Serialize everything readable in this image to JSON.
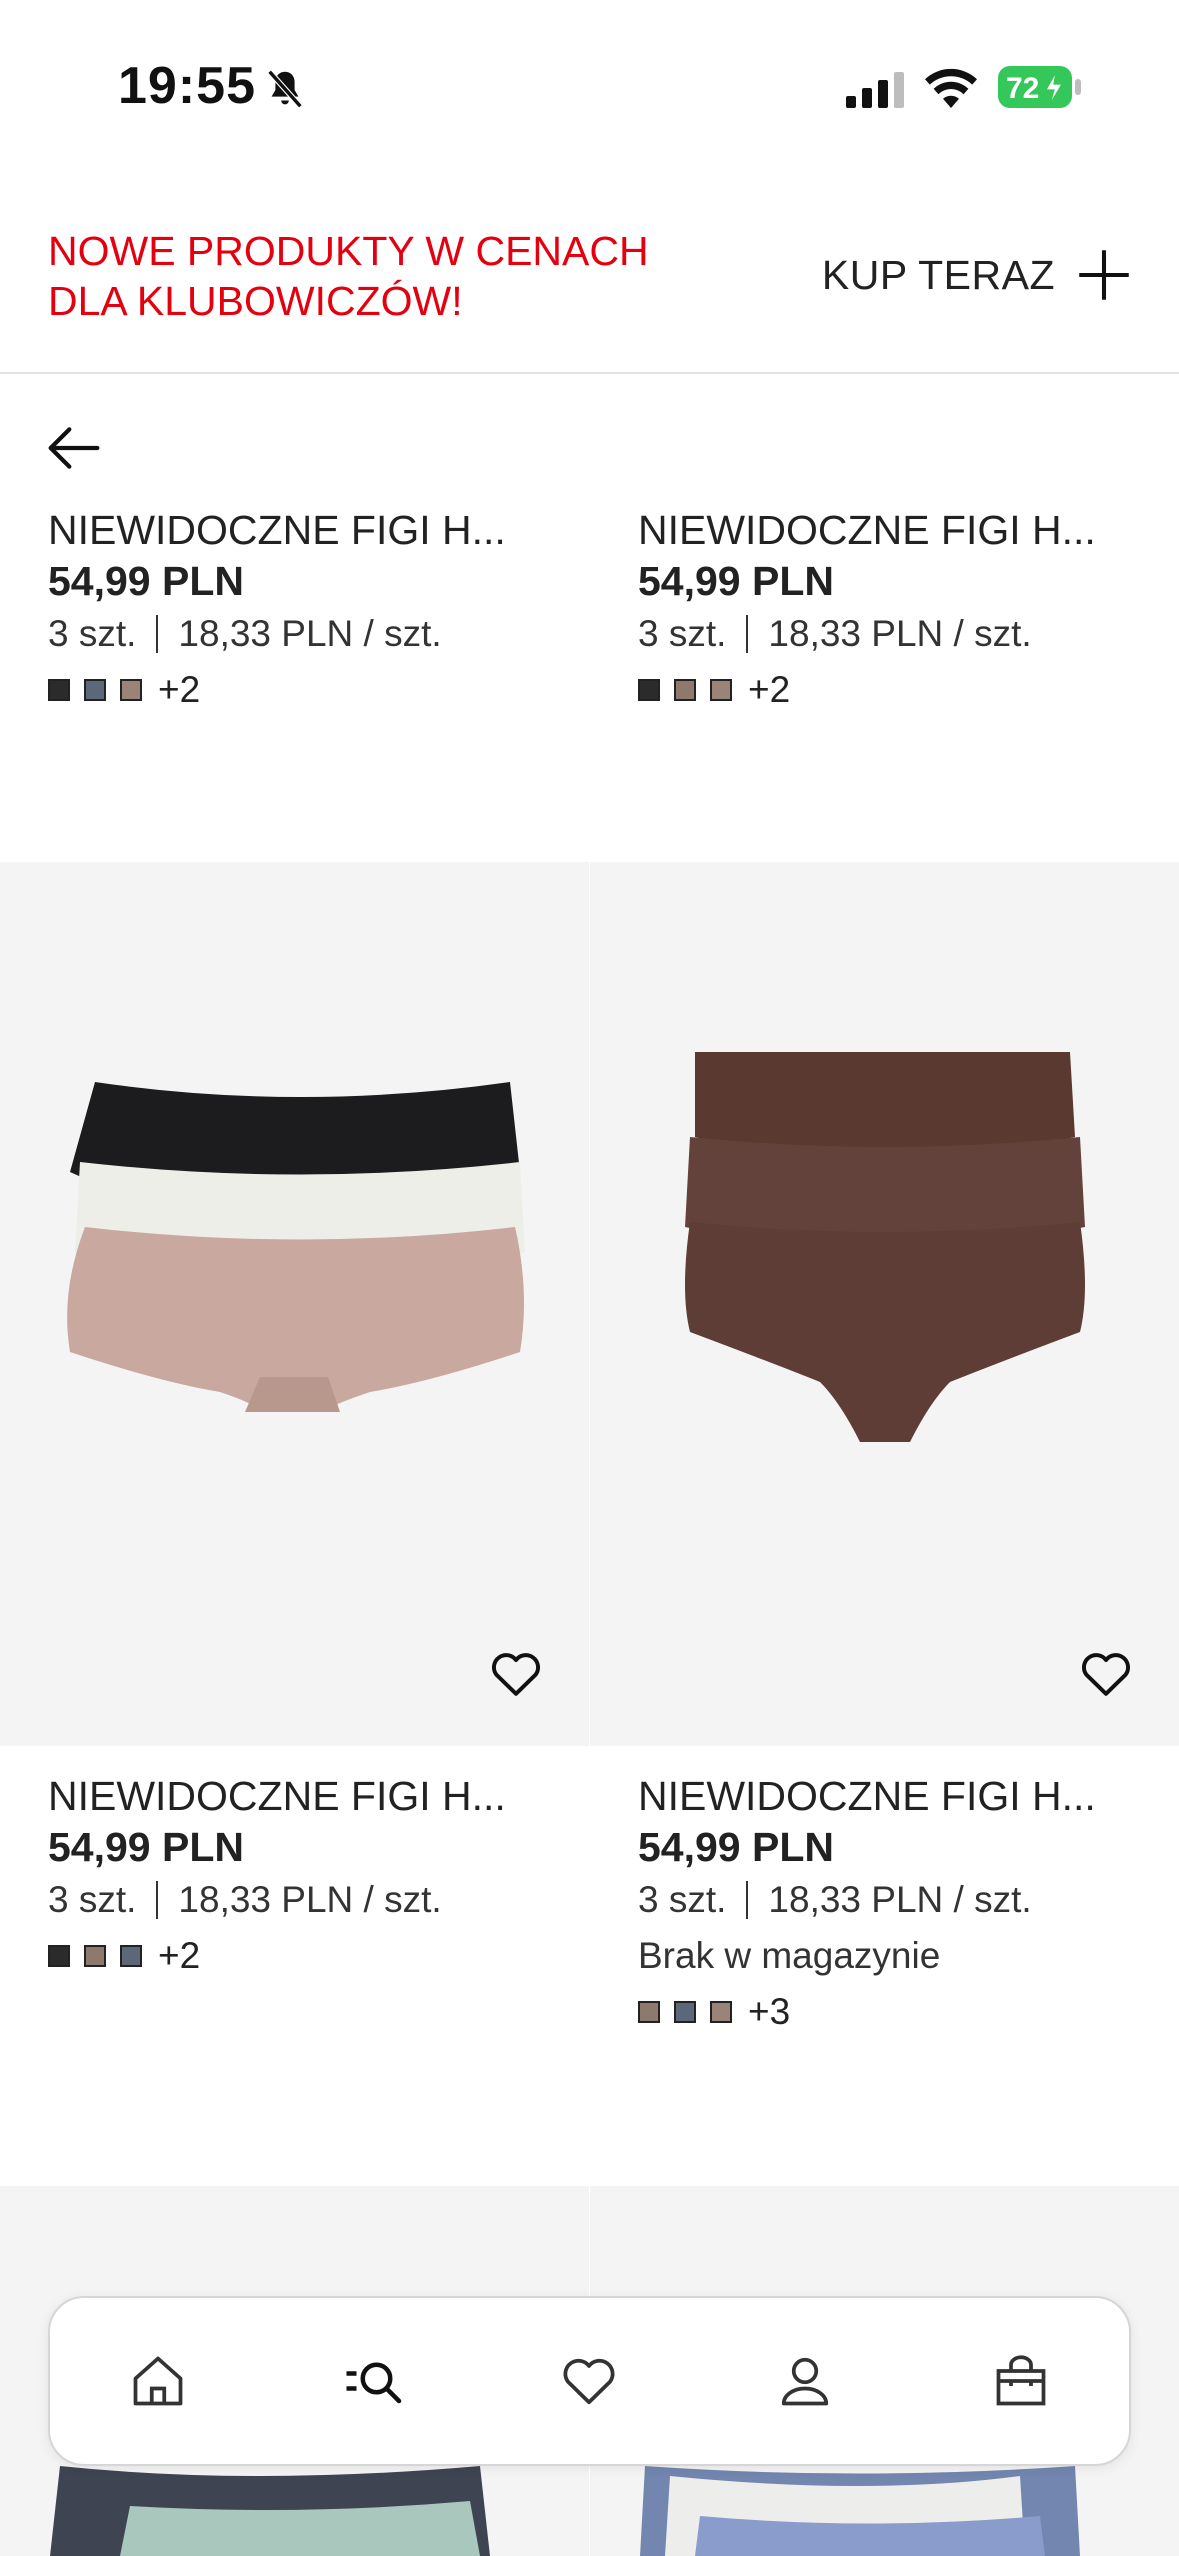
{
  "status_bar": {
    "time": "19:55",
    "battery": "72"
  },
  "promo": {
    "text": "NOWE PRODUKTY W CENACH DLA KLUBOWICZÓW!",
    "cta": "KUP TERAZ"
  },
  "products": [
    {
      "name": "NIEWIDOCZNE FIGI H...",
      "price": "54,99 PLN",
      "qty": "3 szt.",
      "unit_price": "18,33 PLN / szt.",
      "swatches": [
        "#2b2b2b",
        "#5c6878",
        "#9a8478"
      ],
      "more_colors": "+2"
    },
    {
      "name": "NIEWIDOCZNE FIGI H...",
      "price": "54,99 PLN",
      "qty": "3 szt.",
      "unit_price": "18,33 PLN / szt.",
      "swatches": [
        "#2b2b2b",
        "#8e7a6c",
        "#9a8478"
      ],
      "more_colors": "+2"
    },
    {
      "name": "NIEWIDOCZNE FIGI H...",
      "price": "54,99 PLN",
      "qty": "3 szt.",
      "unit_price": "18,33 PLN / szt.",
      "swatches": [
        "#2b2b2b",
        "#8e7a6c",
        "#5c6878"
      ],
      "more_colors": "+2"
    },
    {
      "name": "NIEWIDOCZNE FIGI H...",
      "price": "54,99 PLN",
      "qty": "3 szt.",
      "unit_price": "18,33 PLN / szt.",
      "stock": "Brak w magazynie",
      "swatches": [
        "#8e7a6c",
        "#5c6878",
        "#9a8478"
      ],
      "more_colors": "+3"
    }
  ],
  "icons": {
    "status": [
      "bell-off-icon",
      "signal-icon",
      "wifi-icon",
      "battery-icon"
    ],
    "nav": [
      "home-icon",
      "search-icon",
      "heart-icon",
      "account-icon",
      "bag-icon"
    ]
  },
  "colors": {
    "promo_red": "#e50010",
    "battery_green": "#34c759",
    "image_bg": "#f4f4f4"
  }
}
